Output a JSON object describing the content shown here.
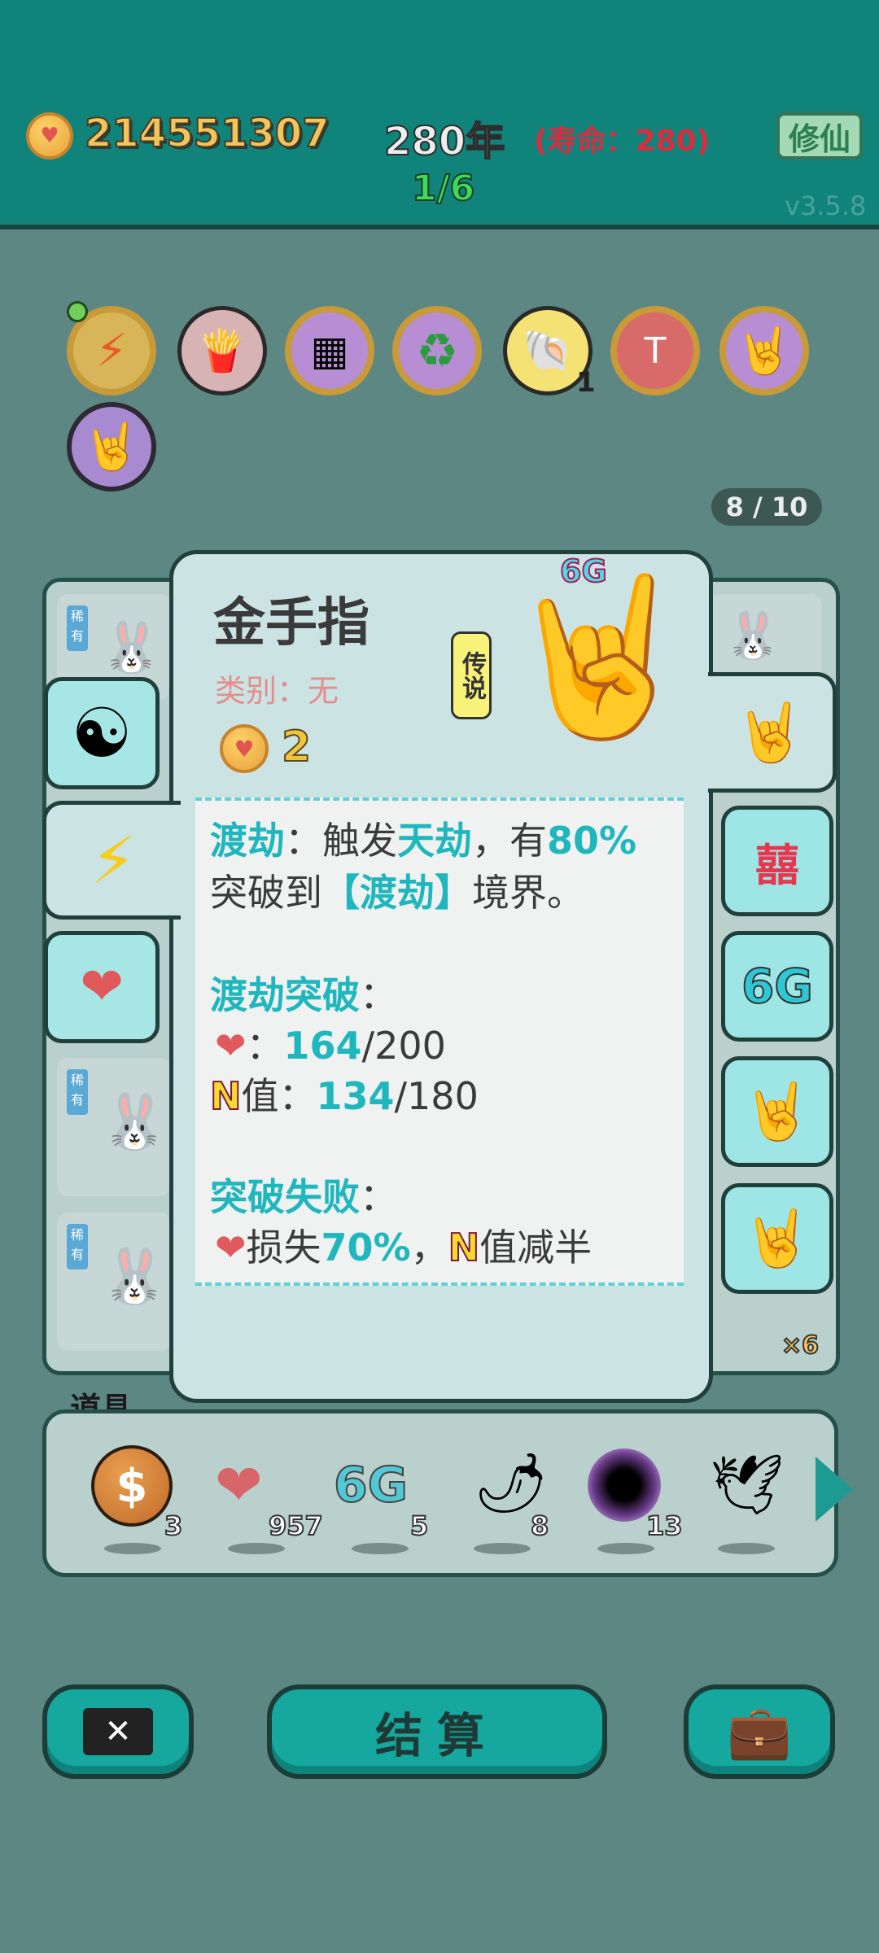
{
  "header": {
    "coins": "214551307",
    "year": "280年",
    "lifespan": "(寿命：280)",
    "progress": "1/6",
    "cultivate_label": "修仙",
    "version": "v3.5.8"
  },
  "relics": {
    "icons": [
      "lightning-relic-icon",
      "fries-relic-icon",
      "tissue-box-relic-icon",
      "recycle-relic-icon",
      "shell-relic-icon",
      "time-magazine-relic-icon",
      "rock-hand-relic-icon",
      "rock-hand-purple-relic-icon"
    ],
    "shell_count": "1",
    "page_counter": "8 / 10"
  },
  "popup": {
    "title": "金手指",
    "category": "类别：无",
    "cost": "2",
    "rarity": "传说",
    "top_tag": "6G",
    "desc_line1_a": "渡劫",
    "desc_line1_b": "：触发",
    "desc_line1_c": "天劫",
    "desc_line1_d": "，有",
    "desc_line1_e": "80%",
    "desc_line2_a": "突破到",
    "desc_line2_b": "【渡劫】",
    "desc_line2_c": "境界。",
    "breakthrough_title": "渡劫突破",
    "breakthrough_colon": "：",
    "liver_colon": "：",
    "liver_current": "164",
    "liver_total": "/200",
    "n_label": "N",
    "n_value_label": "值：",
    "n_current": "134",
    "n_total": "/180",
    "fail_title": "突破失败",
    "fail_colon": "：",
    "fail_loss": "损失",
    "fail_pct": "70%",
    "fail_comma": "，",
    "fail_n": "N",
    "fail_n_text": "值减半"
  },
  "side_cards": {
    "right_6g": "6G",
    "multiplier": "×6",
    "rare_tag": "稀有"
  },
  "items": {
    "title": "道具",
    "list": [
      {
        "icon": "dollar-coin-icon",
        "count": "3"
      },
      {
        "icon": "liver-icon",
        "count": "957"
      },
      {
        "icon": "6g-icon",
        "label": "6G",
        "count": "5"
      },
      {
        "icon": "chili-icon",
        "count": "8"
      },
      {
        "icon": "black-hole-icon",
        "count": "13"
      },
      {
        "icon": "pigeon-icon",
        "count": ""
      }
    ]
  },
  "bottom": {
    "settle_label": "结算"
  },
  "colors": {
    "header_bg": "#10837a",
    "page_bg": "#5d8783",
    "teal_accent": "#1fb7bd",
    "gold_text": "#f3c45c"
  }
}
